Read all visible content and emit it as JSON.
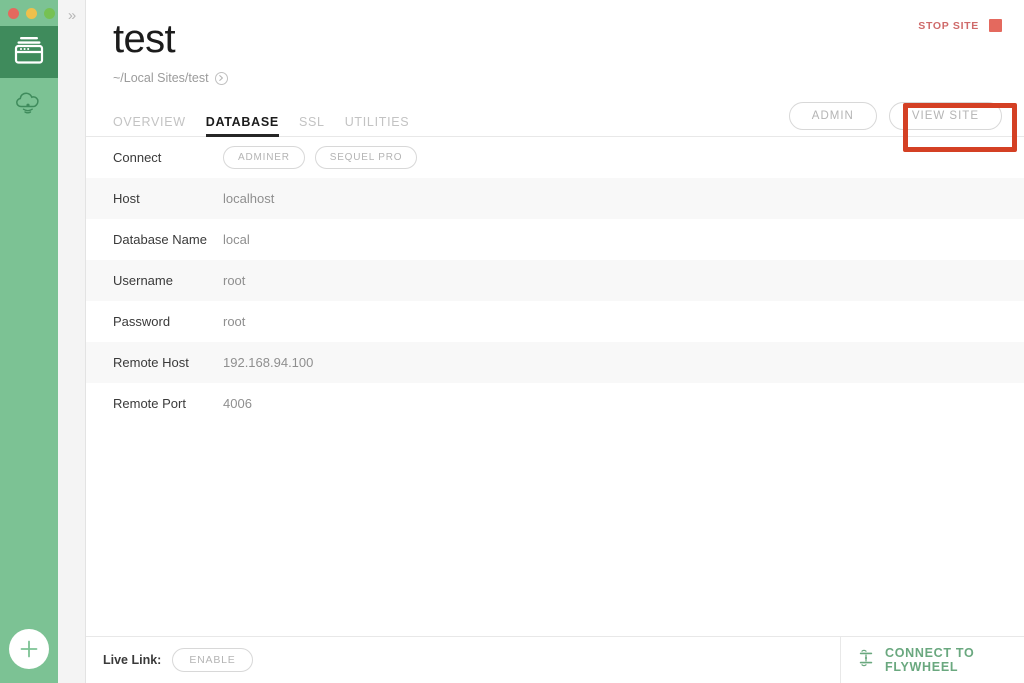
{
  "window": {
    "traffic_lights": [
      {
        "name": "close",
        "color": "#e4695e"
      },
      {
        "name": "minimize",
        "color": "#eec04c"
      },
      {
        "name": "zoom",
        "color": "#76c153"
      }
    ]
  },
  "rail": {
    "background": "#7cc294",
    "active_background": "#3f8b5c",
    "items": [
      {
        "icon": "sites-icon",
        "name": "sites",
        "active": true
      },
      {
        "icon": "cloud-icon",
        "name": "cloud",
        "active": false
      }
    ],
    "add_button": {
      "icon": "plus-icon",
      "name": "add-site"
    }
  },
  "panel_strip": {
    "expand_icon": "chevron-double-right-icon",
    "expand_glyph": "»"
  },
  "site": {
    "title": "test",
    "path": "~/Local Sites/test",
    "path_reveal_icon": "chevron-right-circle-icon",
    "stop_site_label": "STOP SITE",
    "stop_icon": "stop-square-icon",
    "stop_color": "#cf6a6a",
    "stop_square_color": "#e4695e"
  },
  "tabs": [
    {
      "label": "OVERVIEW",
      "active": false
    },
    {
      "label": "DATABASE",
      "active": true
    },
    {
      "label": "SSL",
      "active": false
    },
    {
      "label": "UTILITIES",
      "active": false
    }
  ],
  "head_actions": [
    {
      "label": "ADMIN",
      "name": "admin-button",
      "highlighted": false
    },
    {
      "label": "VIEW SITE",
      "name": "view-site-button",
      "highlighted": true
    }
  ],
  "highlight": {
    "color": "#d44024",
    "target": "view-site-button"
  },
  "database": {
    "connect": {
      "label": "Connect",
      "buttons": [
        {
          "label": "ADMINER",
          "name": "adminer-button"
        },
        {
          "label": "SEQUEL PRO",
          "name": "sequel-pro-button"
        }
      ]
    },
    "fields": [
      {
        "label": "Host",
        "value": "localhost"
      },
      {
        "label": "Database Name",
        "value": "local"
      },
      {
        "label": "Username",
        "value": "root"
      },
      {
        "label": "Password",
        "value": "root"
      },
      {
        "label": "Remote Host",
        "value": "192.168.94.100"
      },
      {
        "label": "Remote Port",
        "value": "4006"
      }
    ]
  },
  "footer": {
    "live_link_label": "Live Link:",
    "live_link_button": "ENABLE",
    "flywheel_label": "CONNECT TO FLYWHEEL",
    "flywheel_icon": "flywheel-transfer-icon",
    "flywheel_color": "#6aa87f"
  }
}
